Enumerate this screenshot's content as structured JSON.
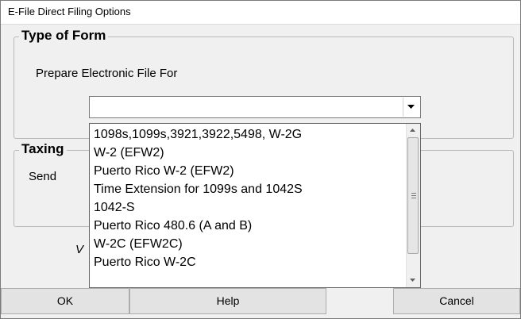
{
  "window": {
    "title": "E-File Direct Filing Options"
  },
  "group_type": {
    "legend": "Type of Form",
    "prepare_label": "Prepare Electronic File For",
    "combo_value": ""
  },
  "group_taxing": {
    "legend_visible": "Taxing",
    "send_label_visible": "Send"
  },
  "hidden_label_fragment": "V",
  "dropdown": {
    "items": [
      "1098s,1099s,3921,3922,5498, W-2G",
      "W-2 (EFW2)",
      "Puerto Rico W-2 (EFW2)",
      "Time Extension for 1099s and 1042S",
      "1042-S",
      "Puerto Rico 480.6 (A and B)",
      "W-2C (EFW2C)",
      "Puerto Rico W-2C"
    ]
  },
  "buttons": {
    "ok": "OK",
    "help": "Help",
    "cancel": "Cancel"
  },
  "icons": [
    "chevron-down-icon",
    "scroll-up-icon",
    "scroll-down-icon"
  ]
}
